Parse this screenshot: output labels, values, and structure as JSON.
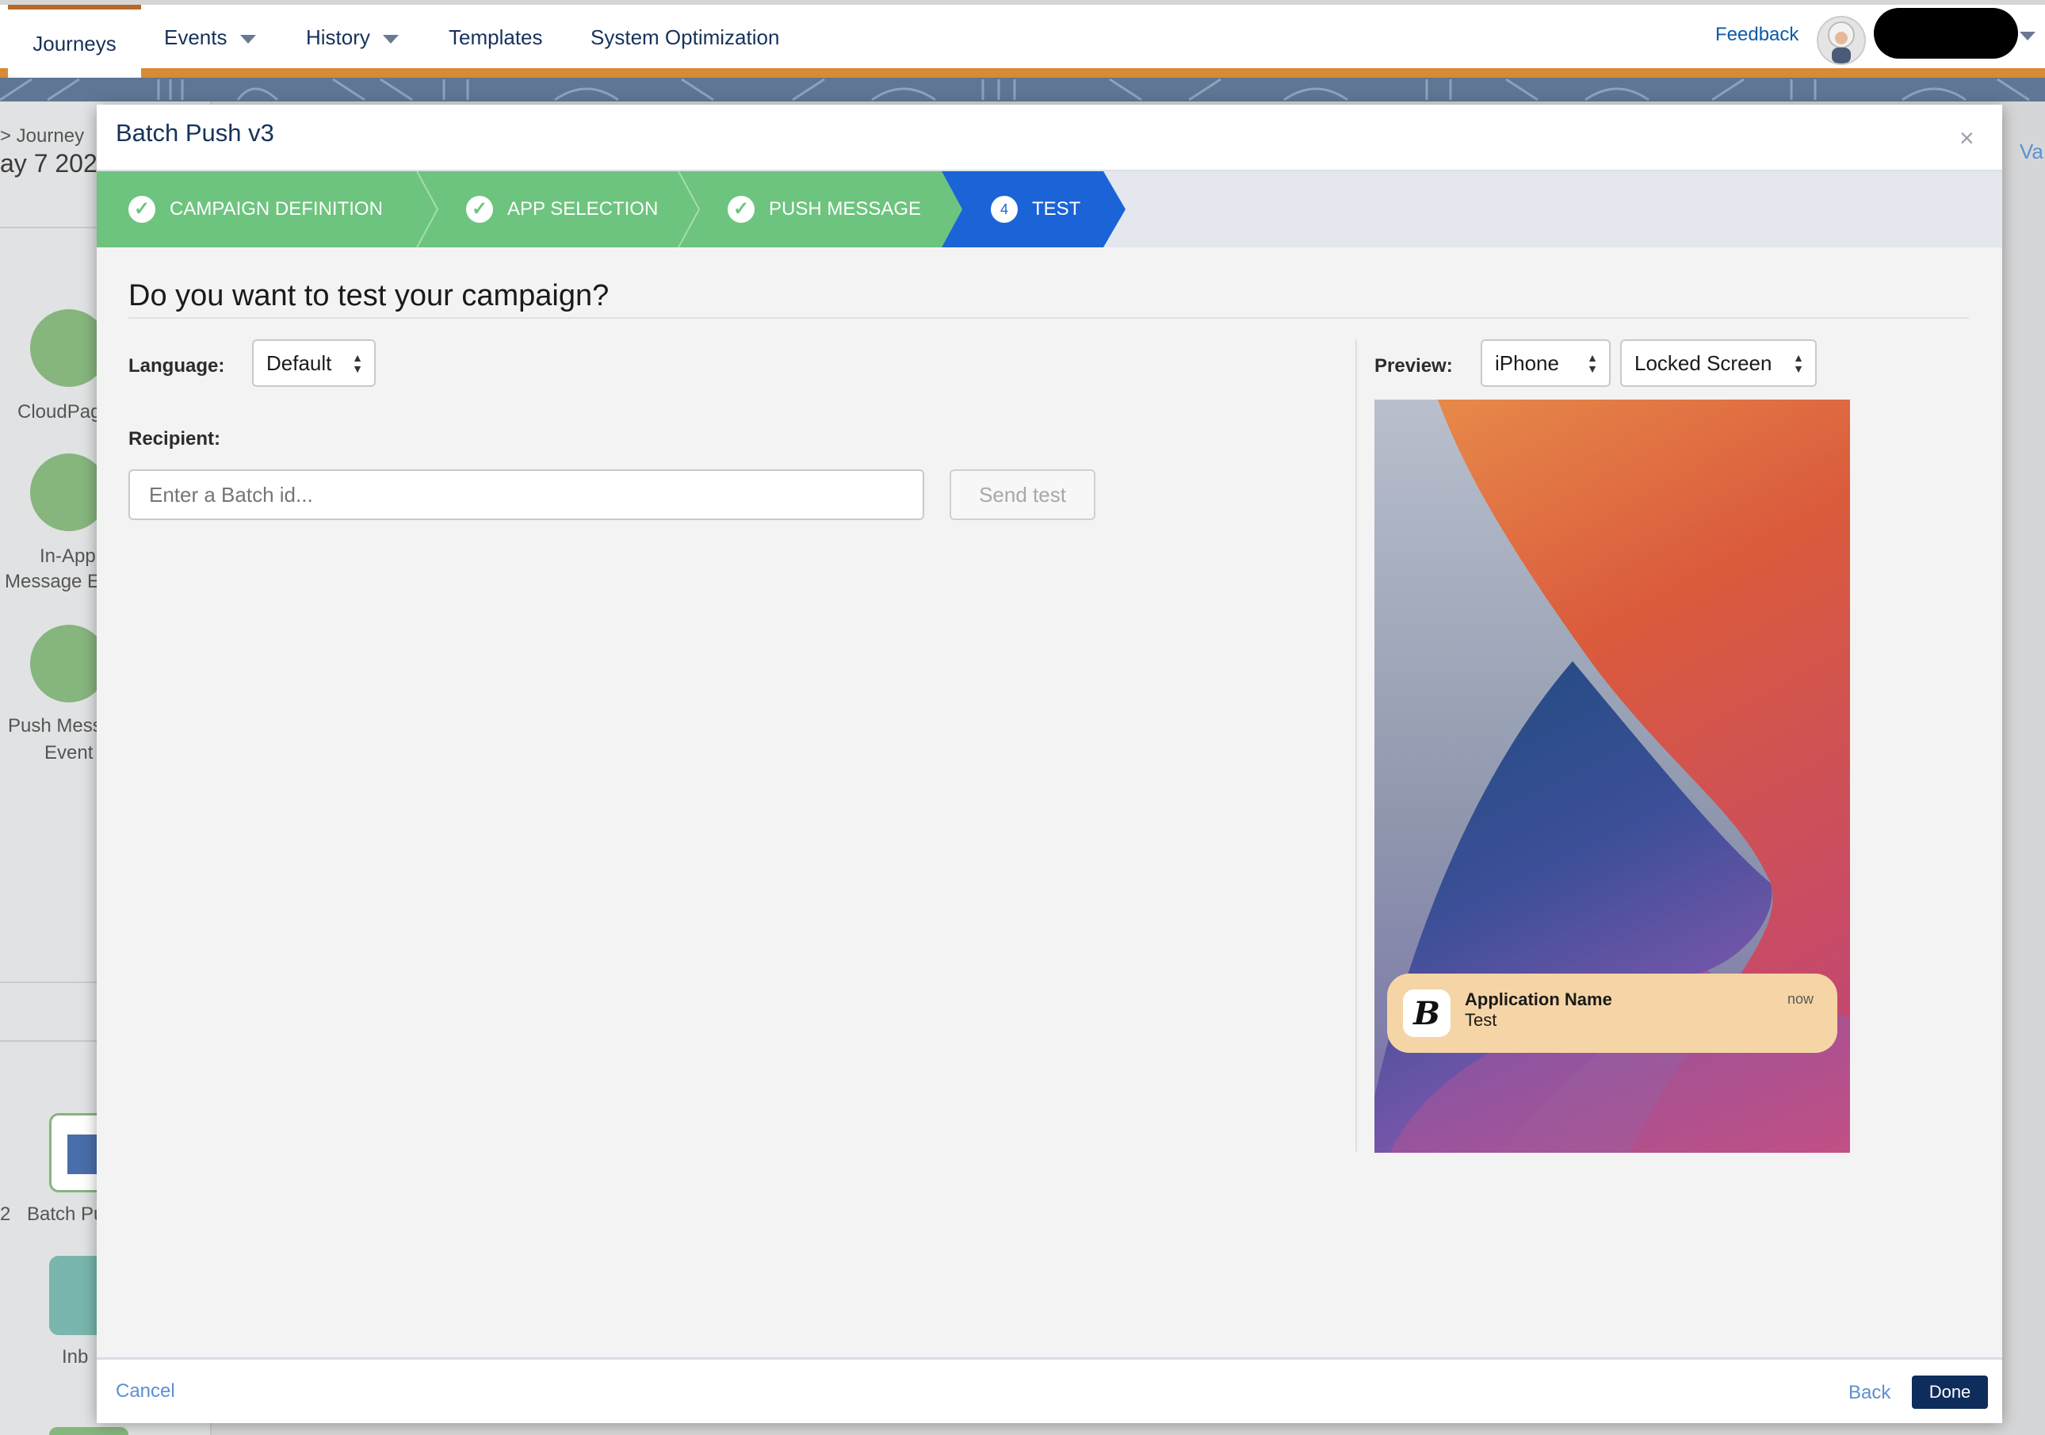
{
  "nav": {
    "tabs": [
      {
        "label": "Journeys"
      },
      {
        "label": "Events"
      },
      {
        "label": "History"
      },
      {
        "label": "Templates"
      },
      {
        "label": "System Optimization"
      }
    ],
    "feedback": "Feedback"
  },
  "background": {
    "breadcrumb": "> Journey",
    "date": "ay 7 202",
    "right_fragment": "Va",
    "activities": [
      {
        "label_1": "CloudPag",
        "label_2": "",
        "icon": "cloudpage-icon"
      },
      {
        "label_1": "In-App",
        "label_2": "Message E",
        "icon": "in-app-message-icon"
      },
      {
        "label_1": "Push Mess",
        "label_2": "Event",
        "icon": "push-message-icon"
      }
    ],
    "canvas_items": [
      {
        "prefix": "2",
        "label": "Batch Pu"
      },
      {
        "label": "Inb"
      }
    ]
  },
  "modal": {
    "title": "Batch Push v3",
    "close_glyph": "×",
    "steps": [
      {
        "label": "CAMPAIGN DEFINITION",
        "state": "done"
      },
      {
        "label": "APP SELECTION",
        "state": "done"
      },
      {
        "label": "PUSH MESSAGE",
        "state": "done"
      },
      {
        "label": "TEST",
        "state": "active",
        "number": "4"
      }
    ],
    "heading": "Do you want to test your campaign?",
    "language_label": "Language:",
    "language_value": "Default",
    "recipient_label": "Recipient:",
    "recipient_placeholder": "Enter a Batch id...",
    "recipient_value": "",
    "send_test": "Send test",
    "preview_label": "Preview:",
    "device_value": "iPhone",
    "screen_value": "Locked Screen",
    "notification": {
      "app_name": "Application Name",
      "body": "Test",
      "time": "now",
      "icon_letter": "B"
    },
    "footer": {
      "cancel": "Cancel",
      "back": "Back",
      "done": "Done"
    }
  },
  "colors": {
    "step_done": "#6dc47e",
    "step_active": "#1b64d8",
    "nav_accent": "#d98a34",
    "done_button": "#0f2d5c",
    "notification_bg": "#f5d5a6"
  }
}
